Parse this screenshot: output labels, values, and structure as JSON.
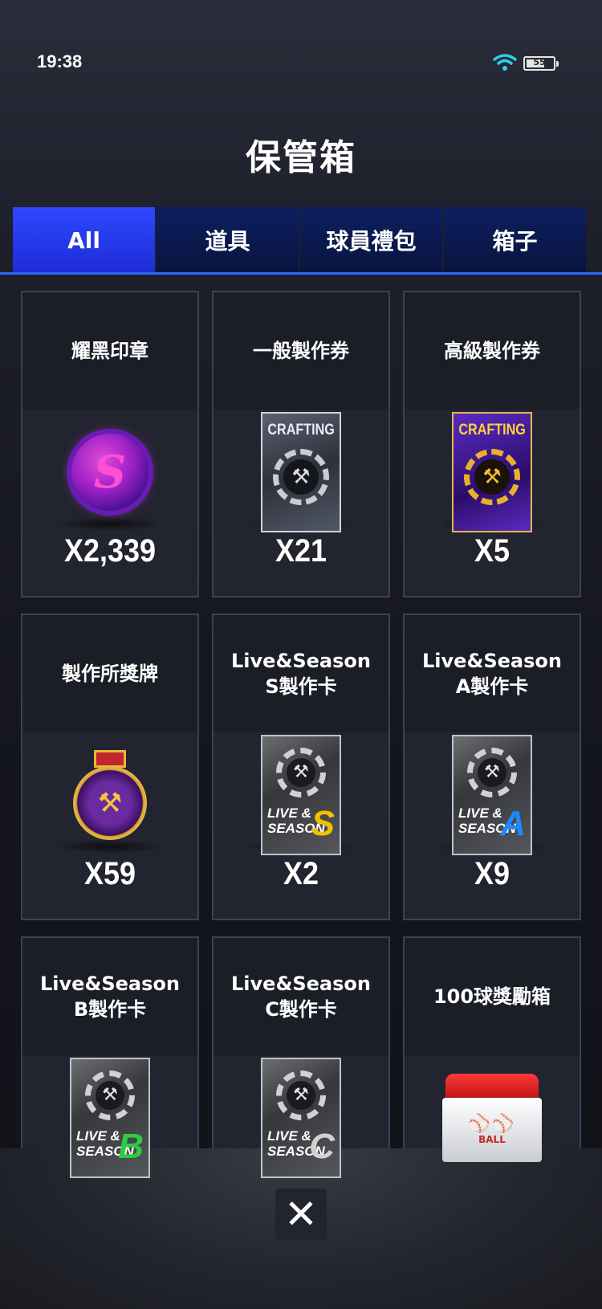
{
  "status": {
    "time": "19:38",
    "battery": "55"
  },
  "title": "保管箱",
  "tabs": [
    {
      "label": "All",
      "active": true
    },
    {
      "label": "道具"
    },
    {
      "label": "球員禮包"
    },
    {
      "label": "箱子"
    }
  ],
  "items": [
    {
      "name": "耀黑印章",
      "count": "X2,339",
      "icon": "seal-icon"
    },
    {
      "name": "一般製作券",
      "count": "X21",
      "icon": "crafting-ticket-icon",
      "image_label": "CRAFTING"
    },
    {
      "name": "高級製作券",
      "count": "X5",
      "icon": "premium-crafting-ticket-icon",
      "image_label": "CRAFTING"
    },
    {
      "name": "製作所獎牌",
      "count": "X59",
      "icon": "medal-icon"
    },
    {
      "name": "Live&Season\nS製作卡",
      "count": "X2",
      "icon": "season-card-icon",
      "image_label": "LIVE &\nSEASON",
      "grade": "S",
      "grade_color": "#f2c200"
    },
    {
      "name": "Live&Season\nA製作卡",
      "count": "X9",
      "icon": "season-card-icon",
      "image_label": "LIVE &\nSEASON",
      "grade": "A",
      "grade_color": "#1e88ff"
    },
    {
      "name": "Live&Season\nB製作卡",
      "icon": "season-card-icon",
      "image_label": "LIVE &\nSEASON",
      "grade": "B",
      "grade_color": "#2ecc40"
    },
    {
      "name": "Live&Season\nC製作卡",
      "icon": "season-card-icon",
      "image_label": "LIVE &\nSEASON",
      "grade": "C",
      "grade_color": "#d0d0d0"
    },
    {
      "name": "100球獎勵箱",
      "icon": "chest-icon",
      "image_label": "BALL"
    }
  ],
  "close_label": "✕"
}
